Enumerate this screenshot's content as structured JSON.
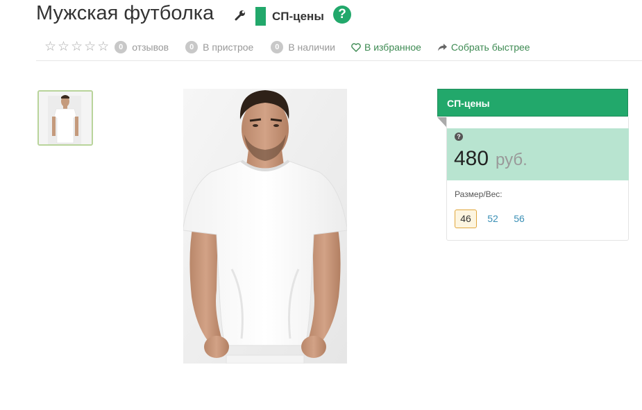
{
  "product": {
    "title": "Мужская футболка",
    "sp_label": "СП-цены",
    "help_icon": "?"
  },
  "meta": {
    "stars_empty": "☆☆☆☆☆",
    "reviews_count": "0",
    "reviews_label": "отзывов",
    "pristroy_count": "0",
    "pristroy_label": "В пристрое",
    "stock_count": "0",
    "stock_label": "В наличии",
    "favorite_label": "В избранное",
    "collect_label": "Собрать быстрее"
  },
  "price_panel": {
    "header": "СП-цены",
    "help_icon": "?",
    "price": "480",
    "currency": "руб.",
    "size_label": "Размер/Вес:",
    "sizes": [
      "46",
      "52",
      "56"
    ],
    "selected_size": "46"
  },
  "colors": {
    "accent": "#22a86b",
    "price_bg": "#b8e4d0",
    "link": "#3d8a52"
  }
}
